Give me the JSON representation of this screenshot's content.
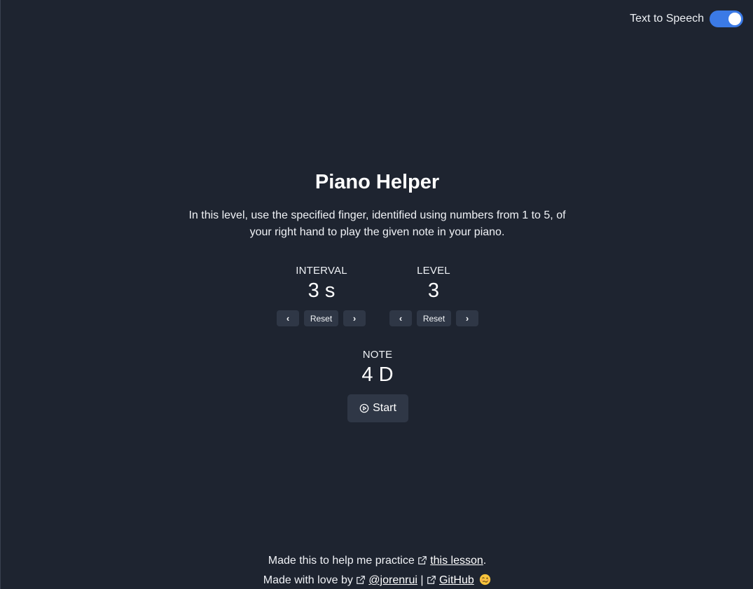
{
  "tts": {
    "label": "Text to Speech",
    "enabled": true,
    "color": "#3b7ae6"
  },
  "header": {
    "title": "Piano Helper"
  },
  "description": {
    "line1": "In this level, use the specified finger, identified using numbers from 1 to 5, of",
    "line2": "your right hand to play the given note in your piano."
  },
  "interval": {
    "label": "INTERVAL",
    "value": "3 s",
    "prev": "‹",
    "reset": "Reset",
    "next": "›"
  },
  "level": {
    "label": "LEVEL",
    "value": "3",
    "prev": "‹",
    "reset": "Reset",
    "next": "›"
  },
  "note": {
    "label": "NOTE",
    "value": "4 D"
  },
  "start": {
    "label": "Start",
    "icon": "play-circle-icon"
  },
  "footer": {
    "line1_prefix": "Made this to help me practice",
    "line1_link": "this lesson",
    "line1_suffix": ".",
    "line2_prefix": "Made with love by",
    "line2_link1": "@jorenrui",
    "line2_sep": "|",
    "line2_link2": "GitHub",
    "emoji_icon": "woozy-face-icon"
  },
  "colors": {
    "background": "#1e2430",
    "button": "#2f3746",
    "accent": "#3b7ae6"
  }
}
